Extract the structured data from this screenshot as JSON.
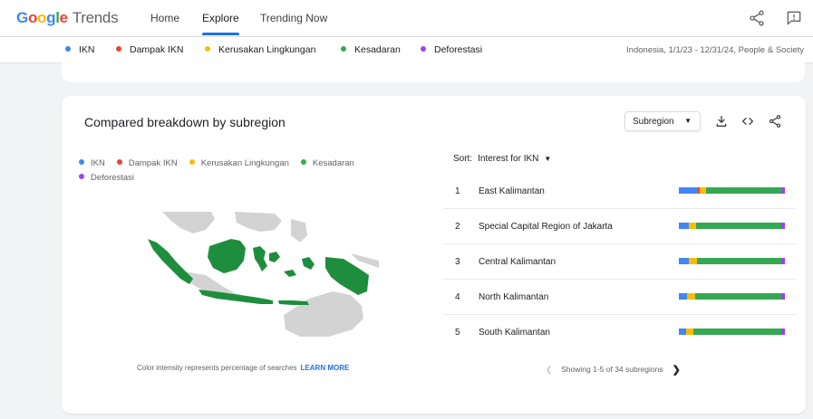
{
  "header": {
    "logo_google": "Google",
    "logo_trends": "Trends",
    "nav": [
      "Home",
      "Explore",
      "Trending Now"
    ],
    "active_nav": 1
  },
  "terms": [
    {
      "label": "IKN",
      "color": "#4285f4"
    },
    {
      "label": "Dampak IKN",
      "color": "#ea4335"
    },
    {
      "label": "Kerusakan Lingkungan",
      "color": "#fbbc04"
    },
    {
      "label": "Kesadaran",
      "color": "#34a853"
    },
    {
      "label": "Deforestasi",
      "color": "#a142f4"
    }
  ],
  "legendbar": {
    "meta": "Indonesia, 1/1/23 - 12/31/24, People & Society"
  },
  "card": {
    "title": "Compared breakdown by subregion",
    "region_button": "Subregion",
    "footnote": "Color intensity represents percentage of searches",
    "learn_more": "LEARN MORE",
    "sort_label": "Sort:",
    "sort_value": "Interest for IKN",
    "pager_text": "Showing 1-5 of 34 subregions"
  },
  "map_colors": {
    "land": "#1e8e3e",
    "other": "#d3d3d3"
  },
  "rows": [
    {
      "rank": "1",
      "name": "East Kalimantan",
      "shares": [
        0.18,
        0.02,
        0.06,
        0.71,
        0.03
      ]
    },
    {
      "rank": "2",
      "name": "Special Capital Region of Jakarta",
      "shares": [
        0.09,
        0.0,
        0.07,
        0.81,
        0.03
      ]
    },
    {
      "rank": "3",
      "name": "Central Kalimantan",
      "shares": [
        0.09,
        0.0,
        0.08,
        0.8,
        0.03
      ]
    },
    {
      "rank": "4",
      "name": "North Kalimantan",
      "shares": [
        0.08,
        0.0,
        0.07,
        0.82,
        0.03
      ]
    },
    {
      "rank": "5",
      "name": "South Kalimantan",
      "shares": [
        0.07,
        0.0,
        0.07,
        0.83,
        0.03
      ]
    }
  ]
}
